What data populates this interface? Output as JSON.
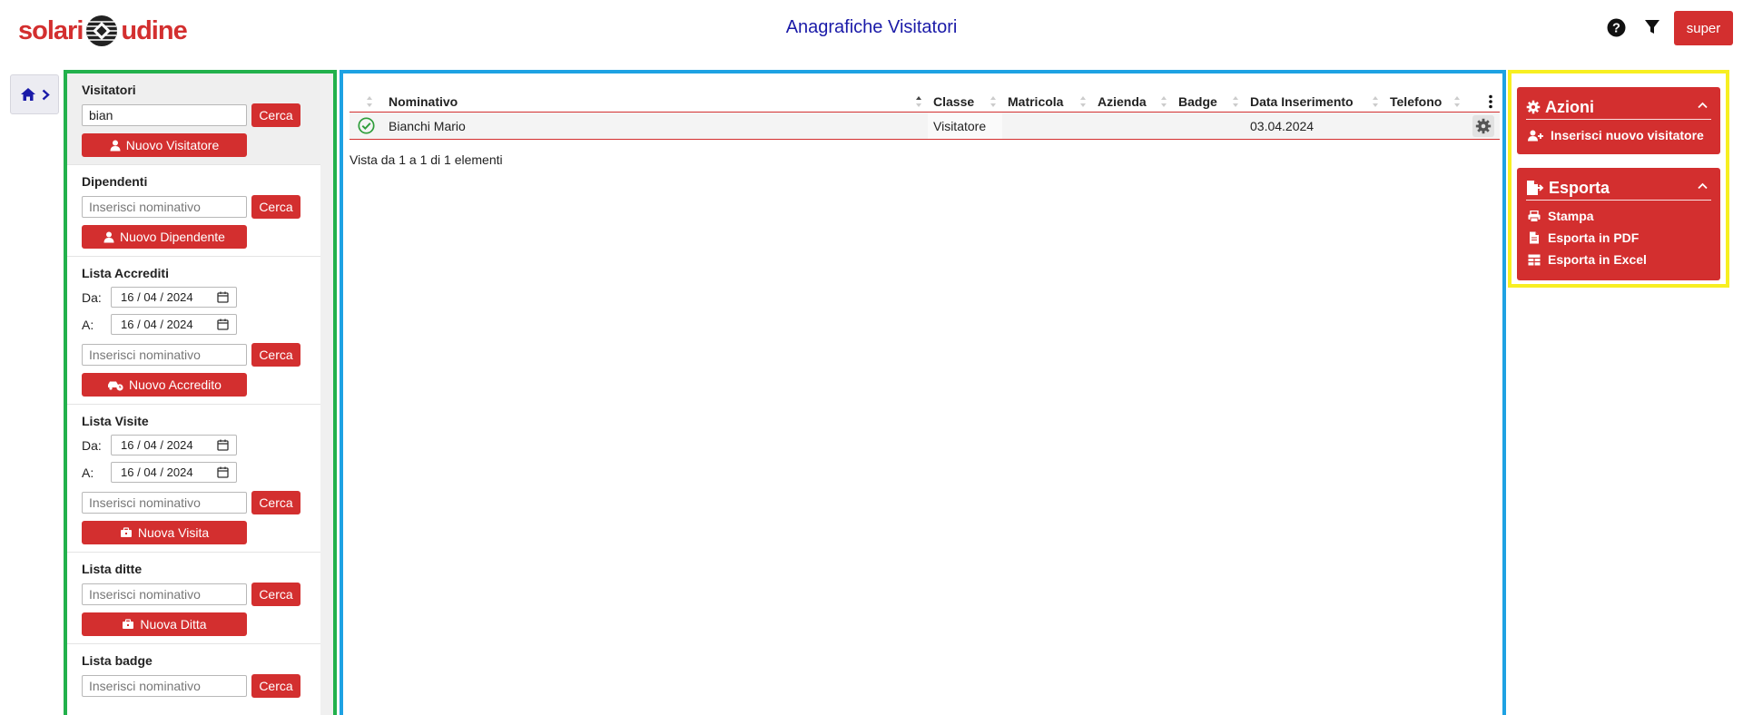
{
  "header": {
    "logo_left": "solari",
    "logo_right": "udine",
    "title": "Anagrafiche Visitatori",
    "help_icon": "question-circle-icon",
    "filter_icon": "filter-icon",
    "user_label": "super"
  },
  "breadcrumb": {
    "home_icon": "home-icon",
    "chevron_icon": "chevron-right-icon"
  },
  "sidebar": {
    "visitatori": {
      "title": "Visitatori",
      "search_value": "bian",
      "search_button": "Cerca",
      "new_button": "Nuovo Visitatore"
    },
    "dipendenti": {
      "title": "Dipendenti",
      "placeholder": "Inserisci nominativo",
      "search_button": "Cerca",
      "new_button": "Nuovo Dipendente"
    },
    "accrediti": {
      "title": "Lista Accrediti",
      "from_label": "Da:",
      "to_label": "A:",
      "from_date": [
        "16",
        "04",
        "2024"
      ],
      "to_date": [
        "16",
        "04",
        "2024"
      ],
      "placeholder": "Inserisci nominativo",
      "search_button": "Cerca",
      "new_button": "Nuovo Accredito"
    },
    "visite": {
      "title": "Lista Visite",
      "from_label": "Da:",
      "to_label": "A:",
      "from_date": [
        "16",
        "04",
        "2024"
      ],
      "to_date": [
        "16",
        "04",
        "2024"
      ],
      "placeholder": "Inserisci nominativo",
      "search_button": "Cerca",
      "new_button": "Nuova Visita"
    },
    "ditte": {
      "title": "Lista ditte",
      "placeholder": "Inserisci nominativo",
      "search_button": "Cerca",
      "new_button": "Nuova Ditta"
    },
    "badge": {
      "title": "Lista badge",
      "placeholder": "Inserisci nominativo",
      "search_button": "Cerca"
    }
  },
  "table": {
    "columns": [
      "Nominativo",
      "Classe",
      "Matricola",
      "Azienda",
      "Badge",
      "Data Inserimento",
      "Telefono"
    ],
    "rows": [
      {
        "status_icon": "check-circle-icon",
        "nominativo": "Bianchi Mario",
        "classe": "Visitatore",
        "matricola": "",
        "azienda": "",
        "badge": "",
        "data_inserimento": "03.04.2024",
        "telefono": ""
      }
    ],
    "info": "Vista da 1 a 1 di 1 elementi"
  },
  "actions": {
    "azioni": {
      "title": "Azioni",
      "items": [
        "Inserisci nuovo visitatore"
      ]
    },
    "esporta": {
      "title": "Esporta",
      "items": [
        "Stampa",
        "Esporta in PDF",
        "Esporta in Excel"
      ]
    }
  },
  "colors": {
    "accent": "#d32f2f",
    "title_blue": "#1a1aa8",
    "left_border": "#22b14c",
    "center_border": "#1ea2e3",
    "right_border": "#f7ef21",
    "status_green": "#2e9d3a"
  }
}
